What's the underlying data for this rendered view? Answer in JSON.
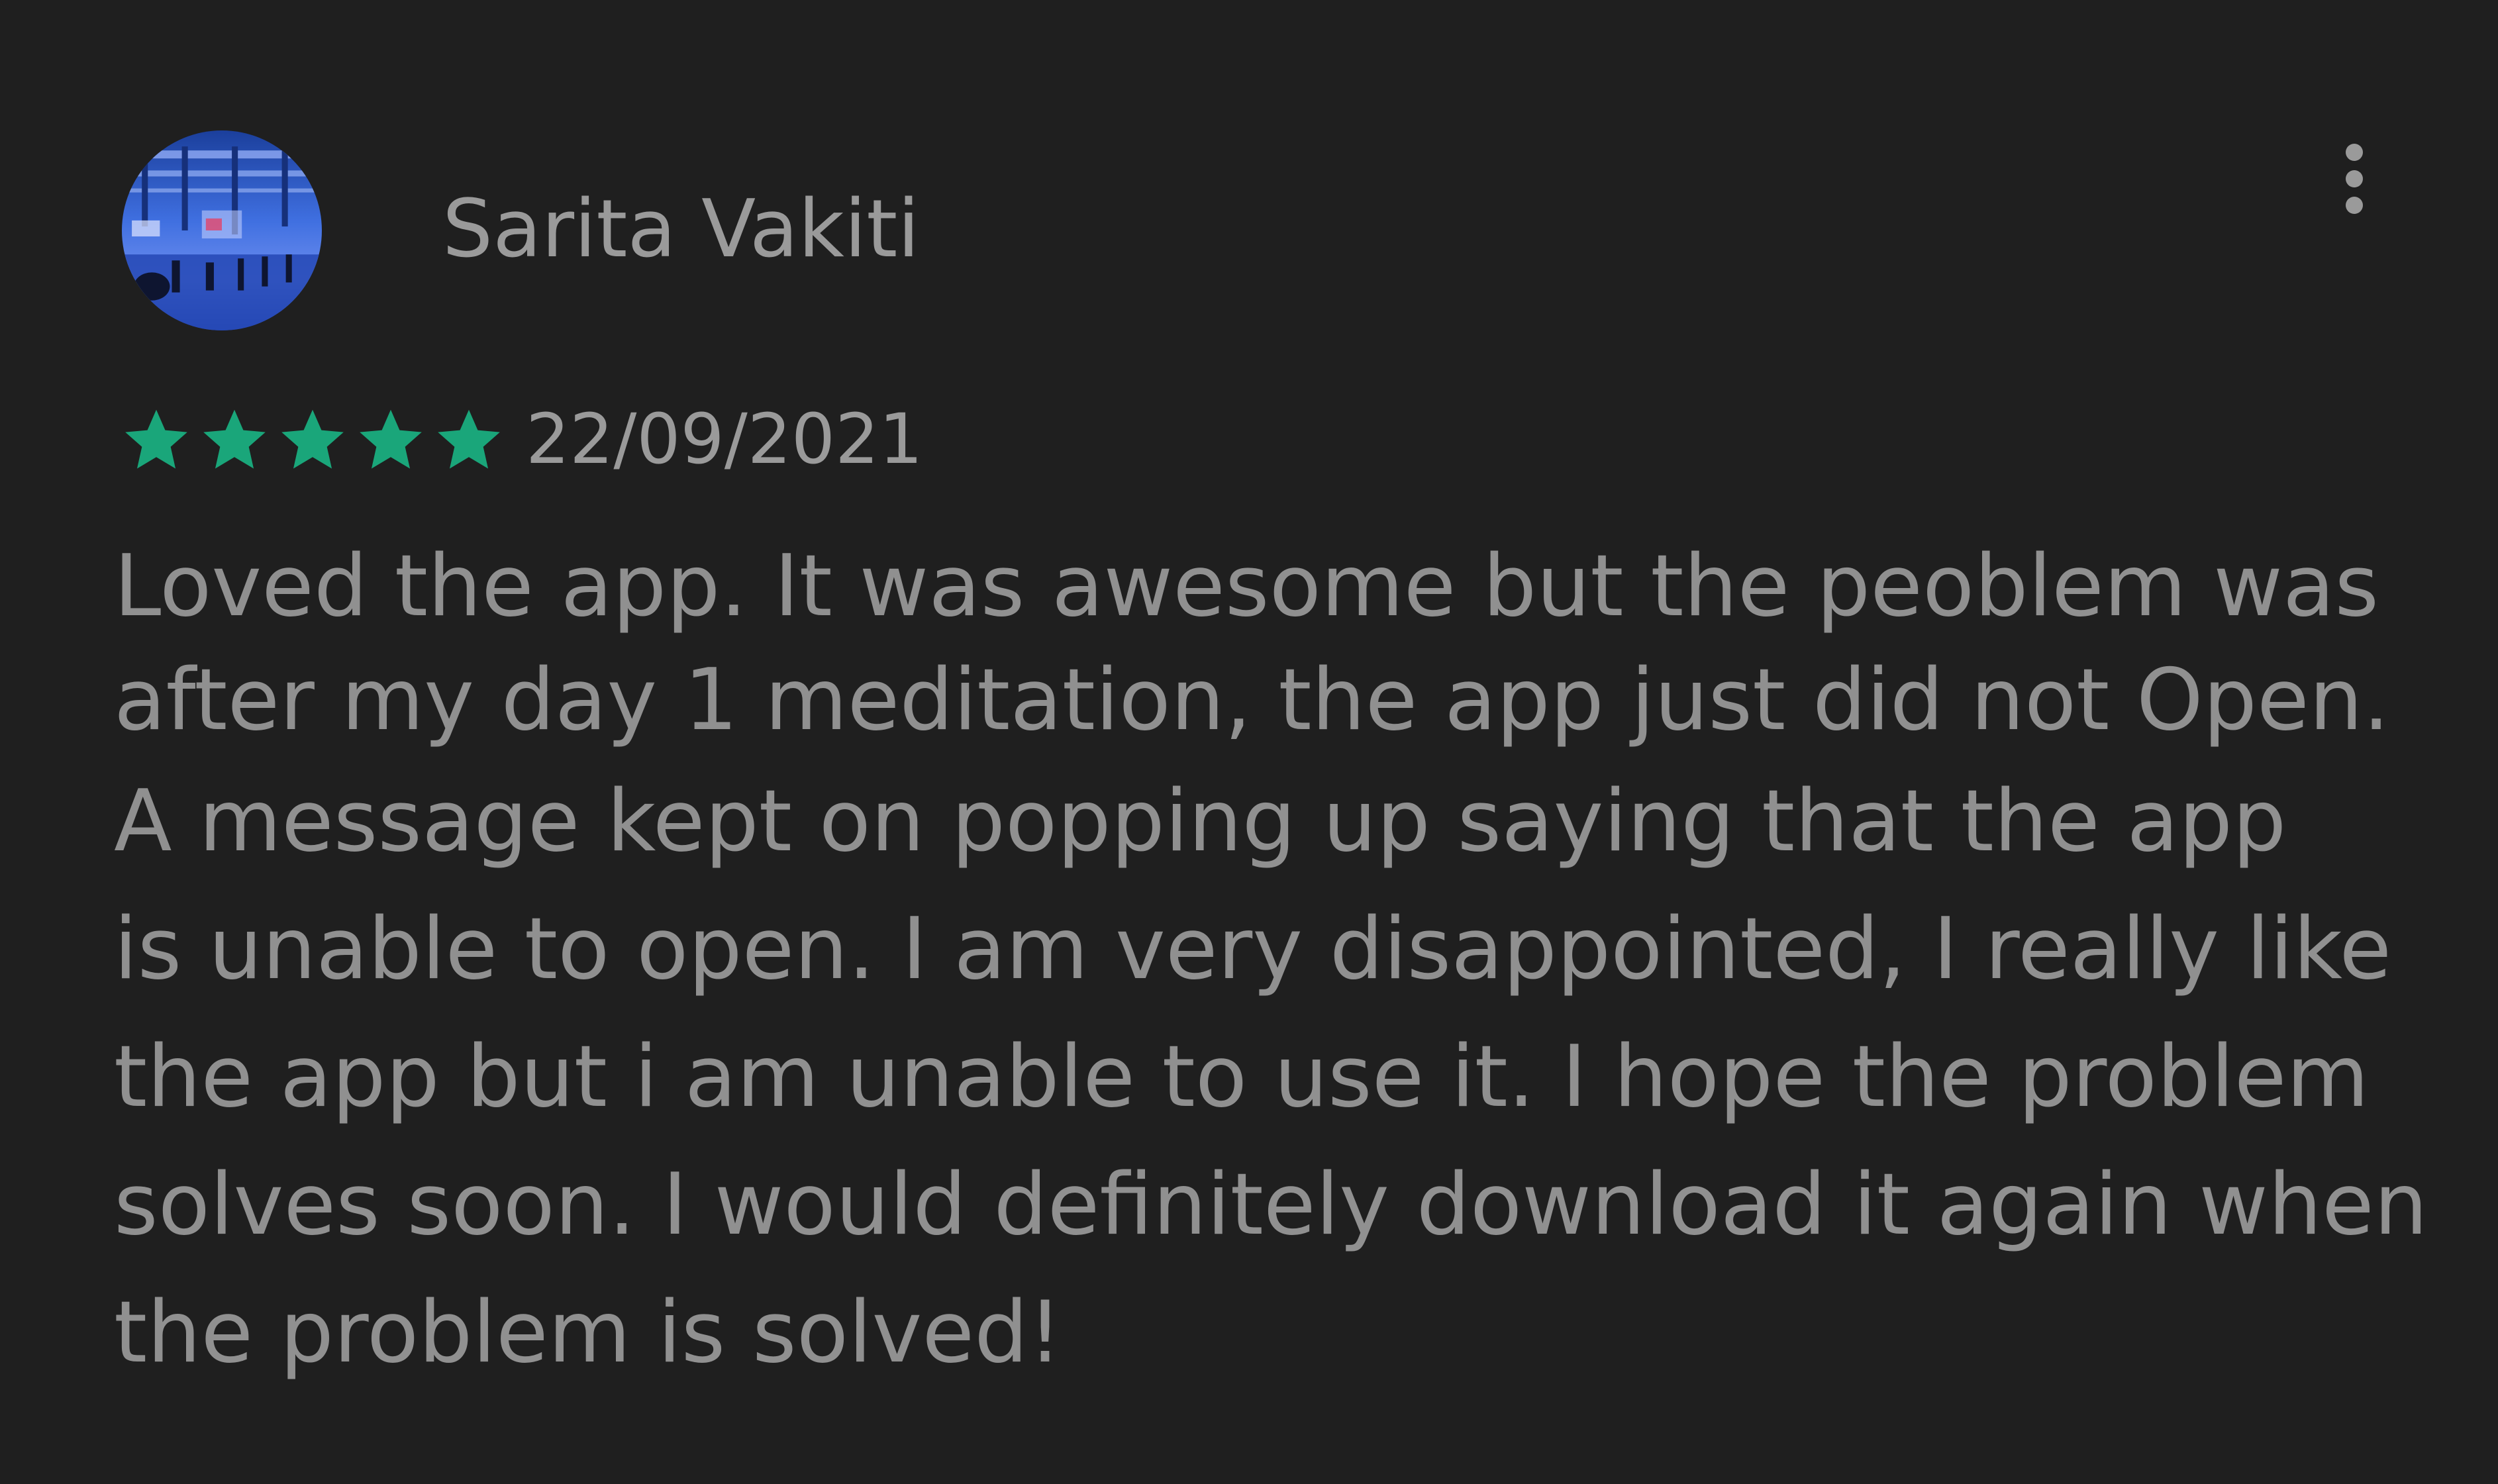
{
  "review": {
    "author": "Sarita Vakiti",
    "date": "22/09/2021",
    "rating": 5,
    "rating_max": 5,
    "star_color": "#1aa67a",
    "body_lines": [
      "Loved the app. It was awesome but the peoblem was",
      "after my day 1 meditation, the app just did not Open.",
      "A message kept on popping up saying that the app",
      "is unable to open. I am very disappointed, I really like",
      "the app but i am unable to use it. I hope the problem",
      "solves soon. I would definitely download it again when",
      "the problem is solved!"
    ]
  },
  "icons": {
    "more": "more-vertical-icon",
    "star": "star-icon"
  },
  "colors": {
    "background": "#1f1f1f",
    "text": "#909090"
  }
}
